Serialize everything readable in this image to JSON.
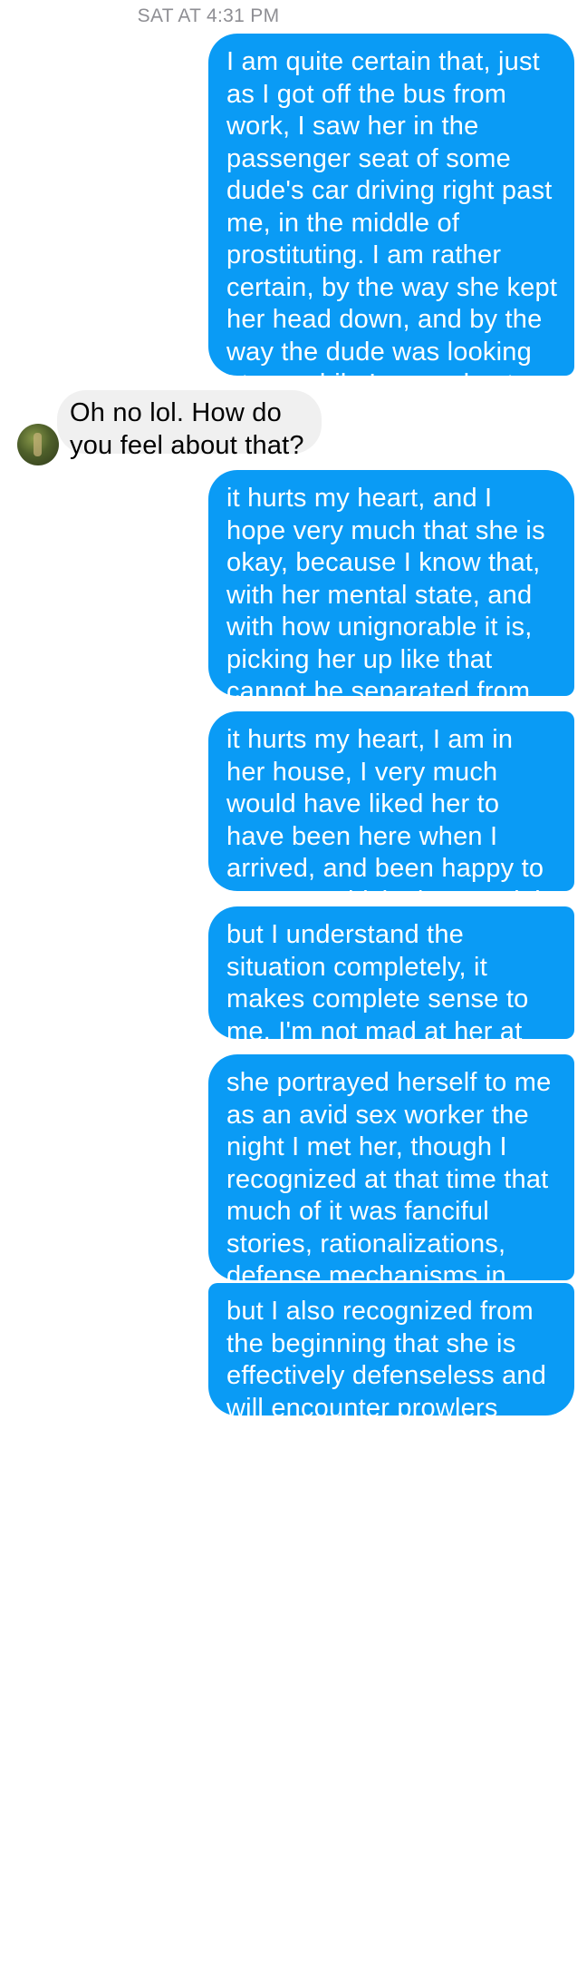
{
  "conversation": {
    "timestamp": "SAT AT 4:31 PM",
    "messages": [
      {
        "sender": "me",
        "text": "I am quite certain that, just as I got off the bus from work, I saw her in the passenger seat of some dude's car driving right past me, in the middle of prostituting. I am rather certain, by the way she kept her head down, and by the way the dude was looking at me while I scoped out the situation, that she also saw me, and was ashamed"
      },
      {
        "sender": "them",
        "text": "Oh no lol. How do you feel about that?"
      },
      {
        "sender": "me",
        "text": "it hurts my heart, and I hope very much that she is okay, because I know that, with her mental state, and with how unignorable it is, picking her up like that cannot be separated from prowling, from exploiting"
      },
      {
        "sender": "me",
        "text": "it hurts my heart, I am in her house, I very much would have liked her to have been here when I arrived, and been happy to see me, which she certainly would've been"
      },
      {
        "sender": "me",
        "text": "but I understand the situation completely, it makes complete sense to me, I'm not mad at her at all, I'm not surprised at all"
      },
      {
        "sender": "me",
        "text": "she portrayed herself to me as an avid sex worker the night I met her, though I recognized at that time that much of it was fanciful stories, rationalizations, defense mechanisms in action, shit like that"
      },
      {
        "sender": "me",
        "text": "but I also recognized from the beginning that she is effectively defenseless and will encounter prowlers"
      }
    ]
  },
  "colors": {
    "outgoing_bubble": "#0a9bf5",
    "incoming_bubble": "#f0f0f0",
    "timestamp": "#8e8e93"
  },
  "icons": {
    "contact_avatar": "contact-avatar-photo"
  }
}
